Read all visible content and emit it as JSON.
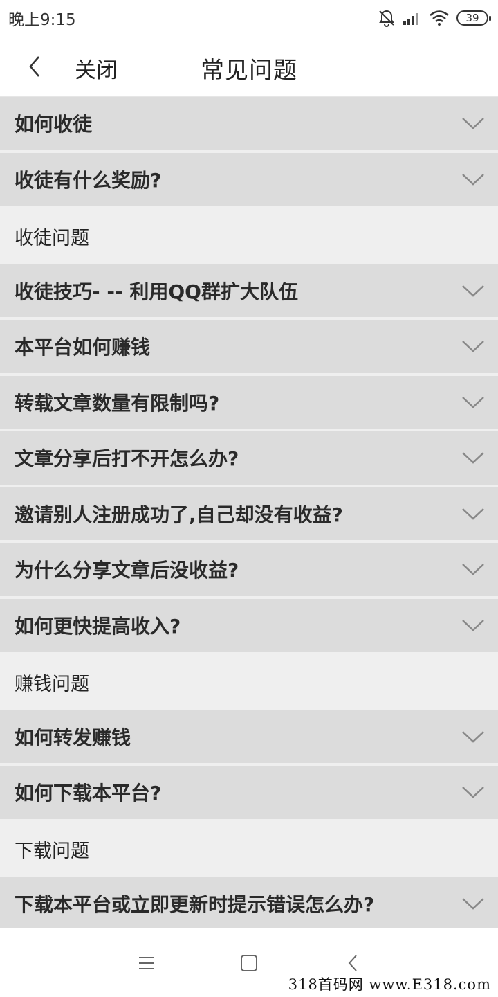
{
  "status_bar": {
    "time": "晚上9:15",
    "battery": "39"
  },
  "header": {
    "close_label": "关闭",
    "title": "常见问题"
  },
  "faq": [
    {
      "type": "question",
      "text": "如何收徒"
    },
    {
      "type": "question",
      "text": "收徒有什么奖励?"
    },
    {
      "type": "section",
      "text": "收徒问题"
    },
    {
      "type": "question",
      "text": "收徒技巧- -- 利用QQ群扩大队伍"
    },
    {
      "type": "question",
      "text": "本平台如何赚钱"
    },
    {
      "type": "question",
      "text": "转载文章数量有限制吗?"
    },
    {
      "type": "question",
      "text": "文章分享后打不开怎么办?"
    },
    {
      "type": "question",
      "text": "邀请别人注册成功了,自己却没有收益?"
    },
    {
      "type": "question",
      "text": "为什么分享文章后没收益?"
    },
    {
      "type": "question",
      "text": "如何更快提高收入?"
    },
    {
      "type": "section",
      "text": "赚钱问题"
    },
    {
      "type": "question",
      "text": "如何转发赚钱"
    },
    {
      "type": "question",
      "text": "如何下载本平台?"
    },
    {
      "type": "section",
      "text": "下载问题"
    },
    {
      "type": "question",
      "text": "下载本平台或立即更新时提示错误怎么办?"
    }
  ],
  "nav": {
    "icons": [
      "menu-icon",
      "home-square-icon",
      "back-icon"
    ]
  },
  "watermark": "318首码网 www.E318.com"
}
